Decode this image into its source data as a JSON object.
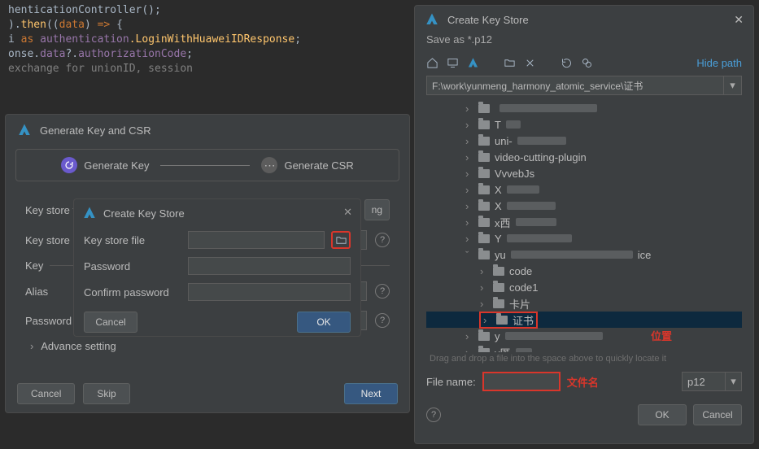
{
  "code": {
    "l1a": "henticationController();",
    "l2a": ".then((data) => {",
    "l3_kw": "as",
    "l3_obj": " authentication",
    "l3_fn": ".LoginWithHuaweiIDResponse",
    "l3_end": ";",
    "l4a": "onse.",
    "l4b": "data",
    "l4c": "?.",
    "l4d": "authorizationCode",
    "l4e": ";",
    "l5": "exchange for unionID, session"
  },
  "gen_panel": {
    "title": "Generate Key and CSR",
    "step1": "Generate Key",
    "step2": "Generate CSR",
    "key_store_file": "Key store fi",
    "key_store_pwd": "Key store p",
    "key_section": "Key",
    "alias": "Alias",
    "password": "Password",
    "advance": "Advance setting",
    "existing_btn": "ng",
    "cancel": "Cancel",
    "skip": "Skip",
    "next": "Next"
  },
  "small_dlg": {
    "title": "Create Key Store",
    "key_store_file": "Key store file",
    "password": "Password",
    "confirm_password": "Confirm password",
    "cancel": "Cancel",
    "ok": "OK"
  },
  "big_dlg": {
    "title": "Create Key Store",
    "save_as": "Save as *.p12",
    "hide_path": "Hide path",
    "path_value": "F:\\work\\yunmeng_harmony_atomic_service\\证书",
    "tree": [
      {
        "indent": 2,
        "chev": "›",
        "label": "",
        "blur_w": 120
      },
      {
        "indent": 2,
        "chev": "›",
        "label": "T",
        "blur_w": 18
      },
      {
        "indent": 2,
        "chev": "›",
        "label": "uni-",
        "blur_w": 60
      },
      {
        "indent": 2,
        "chev": "›",
        "label": "video-cutting-plugin"
      },
      {
        "indent": 2,
        "chev": "›",
        "label": "VvvebJs"
      },
      {
        "indent": 2,
        "chev": "›",
        "label": "X",
        "blur_w": 40
      },
      {
        "indent": 2,
        "chev": "›",
        "label": "X",
        "blur_w": 60
      },
      {
        "indent": 2,
        "chev": "›",
        "label": "x西",
        "blur_w": 50
      },
      {
        "indent": 2,
        "chev": "›",
        "label": "Y",
        "blur_w": 80
      },
      {
        "indent": 2,
        "chev": "ˇ",
        "label": "yu",
        "label2": "ice",
        "blur_w": 150
      },
      {
        "indent": 3,
        "chev": "›",
        "label": "code"
      },
      {
        "indent": 3,
        "chev": "›",
        "label": "code1"
      },
      {
        "indent": 3,
        "chev": "›",
        "label": "卡片"
      },
      {
        "indent": 3,
        "chev": "›",
        "label": "证书",
        "selected": true
      },
      {
        "indent": 2,
        "chev": "›",
        "label": "y",
        "blur_w": 120
      },
      {
        "indent": 2,
        "chev": "›",
        "label": "y匿",
        "blur_w": 20
      }
    ],
    "position_label": "位置",
    "drag_hint": "Drag and drop a file into the space above to quickly locate it",
    "file_name_label": "File name:",
    "file_name_red": "文件名",
    "ext": "p12",
    "ok": "OK",
    "cancel": "Cancel"
  }
}
